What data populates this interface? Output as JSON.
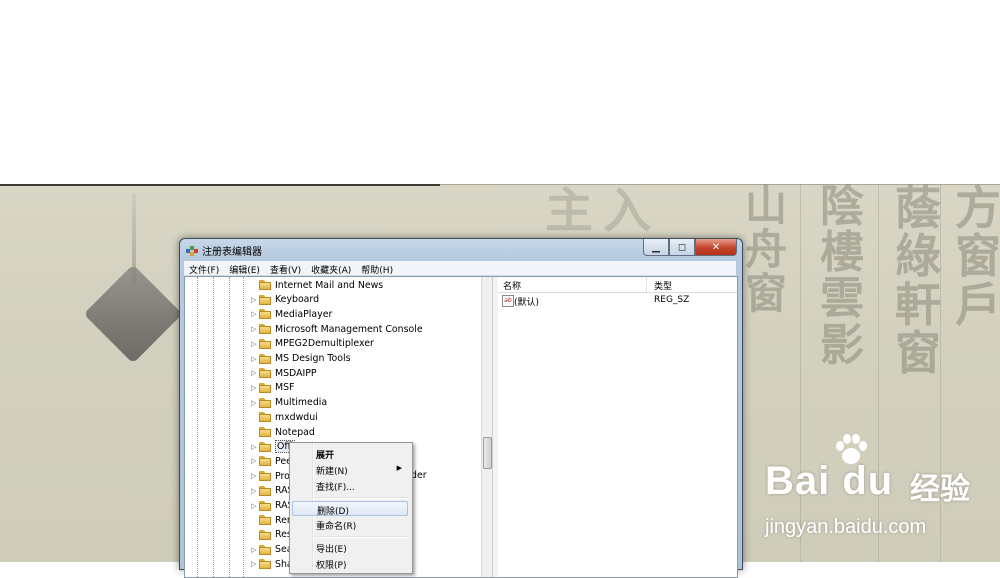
{
  "window": {
    "title": "注册表编辑器",
    "caption_min": "▁",
    "caption_max": "◻",
    "caption_close": "✕"
  },
  "menu": [
    "文件(F)",
    "编辑(E)",
    "查看(V)",
    "收藏夹(A)",
    "帮助(H)"
  ],
  "tree": {
    "items": [
      {
        "label": "Internet Mail and News",
        "expandable": false
      },
      {
        "label": "Keyboard",
        "expandable": true
      },
      {
        "label": "MediaPlayer",
        "expandable": true
      },
      {
        "label": "Microsoft Management Console",
        "expandable": true
      },
      {
        "label": "MPEG2Demultiplexer",
        "expandable": true
      },
      {
        "label": "MS Design Tools",
        "expandable": true
      },
      {
        "label": "MSDAIPP",
        "expandable": true
      },
      {
        "label": "MSF",
        "expandable": true
      },
      {
        "label": "Multimedia",
        "expandable": true
      },
      {
        "label": "mxdwdui",
        "expandable": false
      },
      {
        "label": "Notepad",
        "expandable": false
      },
      {
        "label": "Offi",
        "expandable": true,
        "selected": true
      },
      {
        "label": "Pee",
        "expandable": true
      },
      {
        "label": "Prot",
        "expandable": true
      },
      {
        "label": "RAS",
        "expandable": true
      },
      {
        "label": "RAS",
        "expandable": true
      },
      {
        "label": "Rem",
        "expandable": false
      },
      {
        "label": "Rest",
        "expandable": false
      },
      {
        "label": "Sea",
        "expandable": true
      },
      {
        "label": "Sha",
        "expandable": true
      }
    ],
    "partial_text": "der"
  },
  "list": {
    "columns": [
      "名称",
      "类型"
    ],
    "rows": [
      {
        "name": "(默认)",
        "type": "REG_SZ",
        "icon": "ab"
      }
    ]
  },
  "context_menu": {
    "items": [
      {
        "label": "展开",
        "bold": true
      },
      {
        "label": "新建(N)",
        "submenu": true
      },
      {
        "label": "查找(F)..."
      },
      {
        "separator": true
      },
      {
        "label": "删除(D)",
        "hover": true
      },
      {
        "label": "重命名(R)"
      },
      {
        "separator": true
      },
      {
        "label": "导出(E)"
      },
      {
        "label": "权限(P)"
      }
    ]
  },
  "watermark": {
    "brand": "Bai du",
    "jingyan": "经验",
    "url": "jingyan.baidu.com"
  },
  "background": {
    "calligraphy": [
      "主入",
      "山舟窗",
      "陰樓雲影",
      "蔭綠軒窗",
      "方窗戶"
    ]
  },
  "colors": {
    "titlebar": "#c8d8ea",
    "close_button": "#c2432a",
    "hover_item": "#dde8f5",
    "folder": "#e3b442"
  }
}
